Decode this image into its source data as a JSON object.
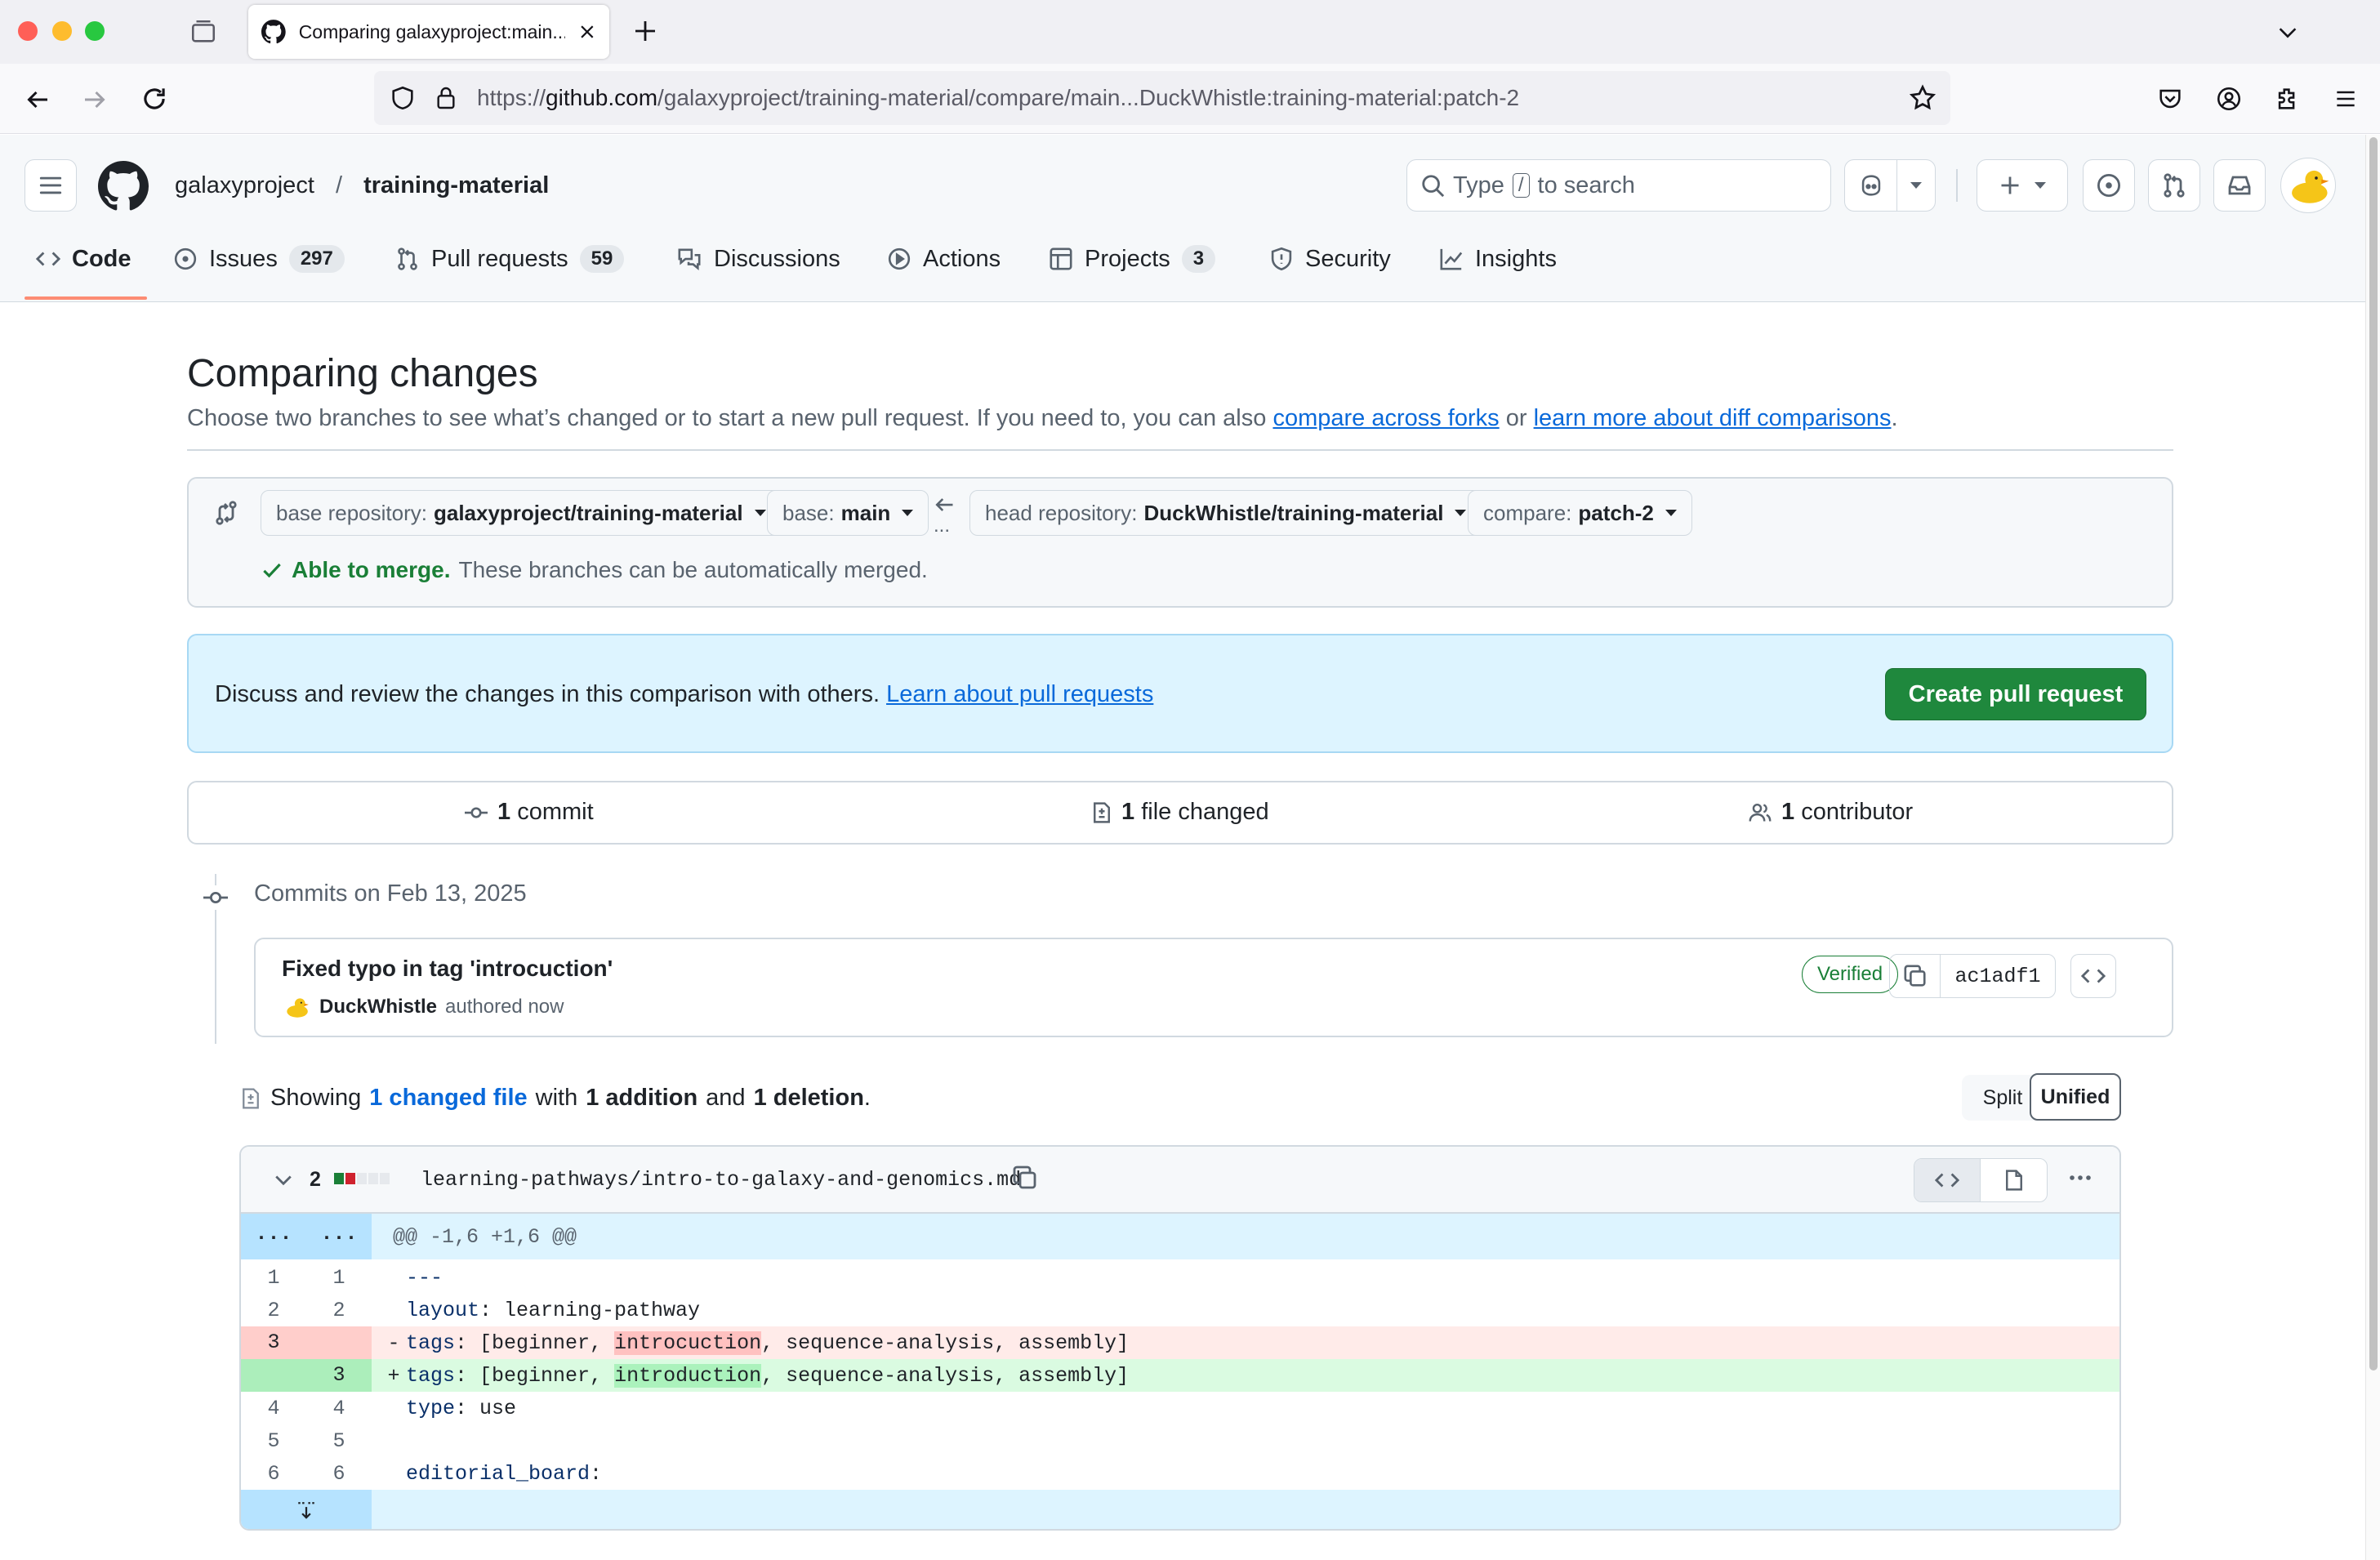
{
  "browser": {
    "tab_title": "Comparing galaxyproject:main...",
    "url_prefix": "https://",
    "url_host": "github.com",
    "url_path": "/galaxyproject/training-material/compare/main...DuckWhistle:training-material:patch-2"
  },
  "header": {
    "owner": "galaxyproject",
    "separator": "/",
    "repo": "training-material",
    "search_pre": "Type",
    "search_key": "/",
    "search_post": "to search"
  },
  "nav": {
    "tabs": [
      {
        "label": "Code"
      },
      {
        "label": "Issues",
        "count": "297"
      },
      {
        "label": "Pull requests",
        "count": "59"
      },
      {
        "label": "Discussions"
      },
      {
        "label": "Actions"
      },
      {
        "label": "Projects",
        "count": "3"
      },
      {
        "label": "Security"
      },
      {
        "label": "Insights"
      }
    ]
  },
  "compare": {
    "title": "Comparing changes",
    "subtitle": "Choose two branches to see what’s changed or to start a new pull request. If you need to, you can also",
    "link1": "compare across forks",
    "or": "or",
    "link2": "learn more about diff comparisons",
    "period": ".",
    "base_repo_label": "base repository:",
    "base_repo": "galaxyproject/training-material",
    "base_label": "base:",
    "base": "main",
    "head_repo_label": "head repository:",
    "head_repo": "DuckWhistle/training-material",
    "compare_label": "compare:",
    "compare_branch": "patch-2",
    "dots": "...",
    "merge_ok": "Able to merge.",
    "merge_msg": "These branches can be automatically merged."
  },
  "banner": {
    "text": "Discuss and review the changes in this comparison with others.",
    "link": "Learn about pull requests",
    "button": "Create pull request"
  },
  "stats": {
    "commits_n": "1",
    "commits": "commit",
    "files_n": "1",
    "files": "file changed",
    "contrib_n": "1",
    "contrib": "contributor"
  },
  "commits": {
    "date_header": "Commits on Feb 13, 2025",
    "items": [
      {
        "message": "Fixed typo in tag 'introcuction'",
        "author": "DuckWhistle",
        "when": "authored now",
        "badge": "Verified",
        "sha": "ac1adf1"
      }
    ]
  },
  "summary": {
    "showing": "Showing",
    "changed": "1 changed file",
    "with": "with",
    "additions": "1 addition",
    "and": "and",
    "deletions": "1 deletion",
    "period": ".",
    "split": "Split",
    "unified": "Unified"
  },
  "file": {
    "changes": "2",
    "path": "learning-pathways/intro-to-galaxy-and-genomics.md",
    "hunk_dots": "...",
    "hunk": "@@ -1,6 +1,6 @@",
    "lines": [
      {
        "old": "1",
        "new": "1",
        "sign": "",
        "text": "---"
      },
      {
        "old": "2",
        "new": "2",
        "sign": "",
        "key": "layout",
        "rest": ": learning-pathway"
      },
      {
        "old": "3",
        "new": "",
        "sign": "-",
        "key": "tags",
        "pre": ": [beginner, ",
        "hl": "introcuction",
        "post": ", sequence-analysis, assembly]"
      },
      {
        "old": "",
        "new": "3",
        "sign": "+",
        "key": "tags",
        "pre": ": [beginner, ",
        "hl": "introduction",
        "post": ", sequence-analysis, assembly]"
      },
      {
        "old": "4",
        "new": "4",
        "sign": "",
        "key": "type",
        "rest": ": use"
      },
      {
        "old": "5",
        "new": "5",
        "sign": "",
        "text": ""
      },
      {
        "old": "6",
        "new": "6",
        "sign": "",
        "key": "editorial_board",
        "rest": ":"
      }
    ]
  }
}
